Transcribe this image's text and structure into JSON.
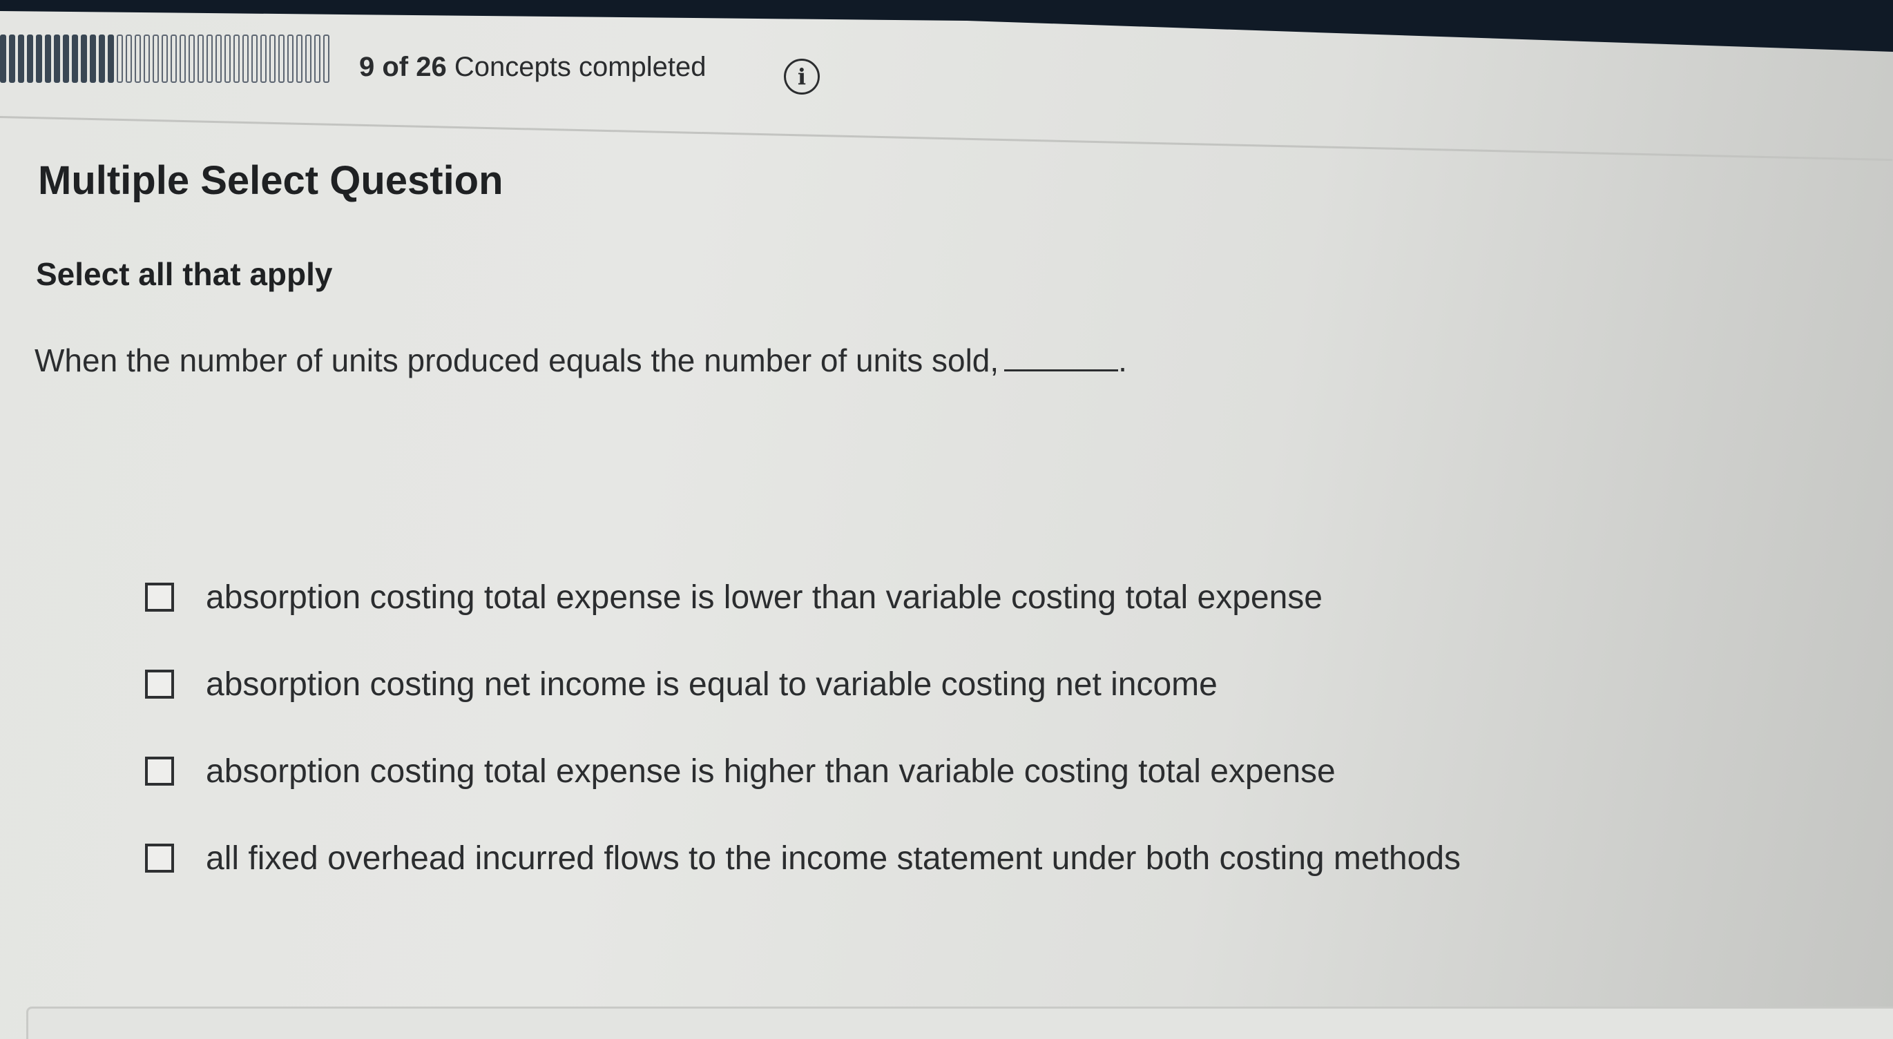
{
  "progress": {
    "completed": 9,
    "total": 26,
    "count_text": "9 of 26",
    "label_text": "Concepts completed",
    "info_icon": "info-icon"
  },
  "question": {
    "type_title": "Multiple Select Question",
    "instruction": "Select all that apply",
    "prompt": "When the number of units produced equals the number of units sold,",
    "prompt_end": "."
  },
  "options": [
    {
      "label": "absorption costing total expense is lower than variable costing total expense",
      "checked": false
    },
    {
      "label": "absorption costing net income is equal to variable costing net income",
      "checked": false
    },
    {
      "label": "absorption costing total expense is higher than variable costing total expense",
      "checked": false
    },
    {
      "label": "all fixed overhead incurred flows to the income statement under both costing methods",
      "checked": false
    }
  ],
  "colors": {
    "progress_done": "#3a4754",
    "progress_todo_border": "#5d6672",
    "text": "#2b2d2f"
  }
}
